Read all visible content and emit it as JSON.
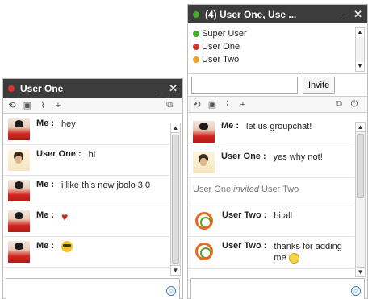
{
  "window1": {
    "title": "User One",
    "status_color": "#d9362b",
    "toolbar": {
      "left_icons": [
        "history-icon",
        "save-icon",
        "clear-icon",
        "add-user-icon"
      ],
      "right_icons": [
        "popout-icon"
      ]
    },
    "messages": [
      {
        "avatar": "female",
        "sender": "Me :",
        "text": "hey"
      },
      {
        "avatar": "male",
        "sender": "User One :",
        "text": "hi"
      },
      {
        "avatar": "female",
        "sender": "Me :",
        "text": "i like this new jbolo 3.0"
      },
      {
        "avatar": "female",
        "sender": "Me :",
        "text": "",
        "emoji": "heart"
      },
      {
        "avatar": "female",
        "sender": "Me :",
        "text": "",
        "emoji": "shades"
      }
    ]
  },
  "window2": {
    "title": "(4) User One, Use ...",
    "status_color": "#3fae2a",
    "members": [
      {
        "name": "Super User",
        "status_color": "#3fae2a"
      },
      {
        "name": "User One",
        "status_color": "#d9362b"
      },
      {
        "name": "User Two",
        "status_color": "#f0a020"
      }
    ],
    "invite_label": "Invite",
    "invite_value": "",
    "toolbar": {
      "left_icons": [
        "history-icon",
        "save-icon",
        "clear-icon",
        "add-user-icon"
      ],
      "right_icons": [
        "popout-icon",
        "power-icon"
      ]
    },
    "messages": [
      {
        "avatar": "female",
        "sender": "Me :",
        "text": "let us groupchat!"
      },
      {
        "avatar": "male",
        "sender": "User One :",
        "text": "yes why not!"
      },
      {
        "system": true,
        "actor": "User One",
        "verb": "invited",
        "target": "User Two"
      },
      {
        "avatar": "head",
        "sender": "User Two :",
        "text": "hi all"
      },
      {
        "avatar": "head",
        "sender": "User Two :",
        "text": "thanks for adding me",
        "emoji": "smile"
      }
    ]
  }
}
